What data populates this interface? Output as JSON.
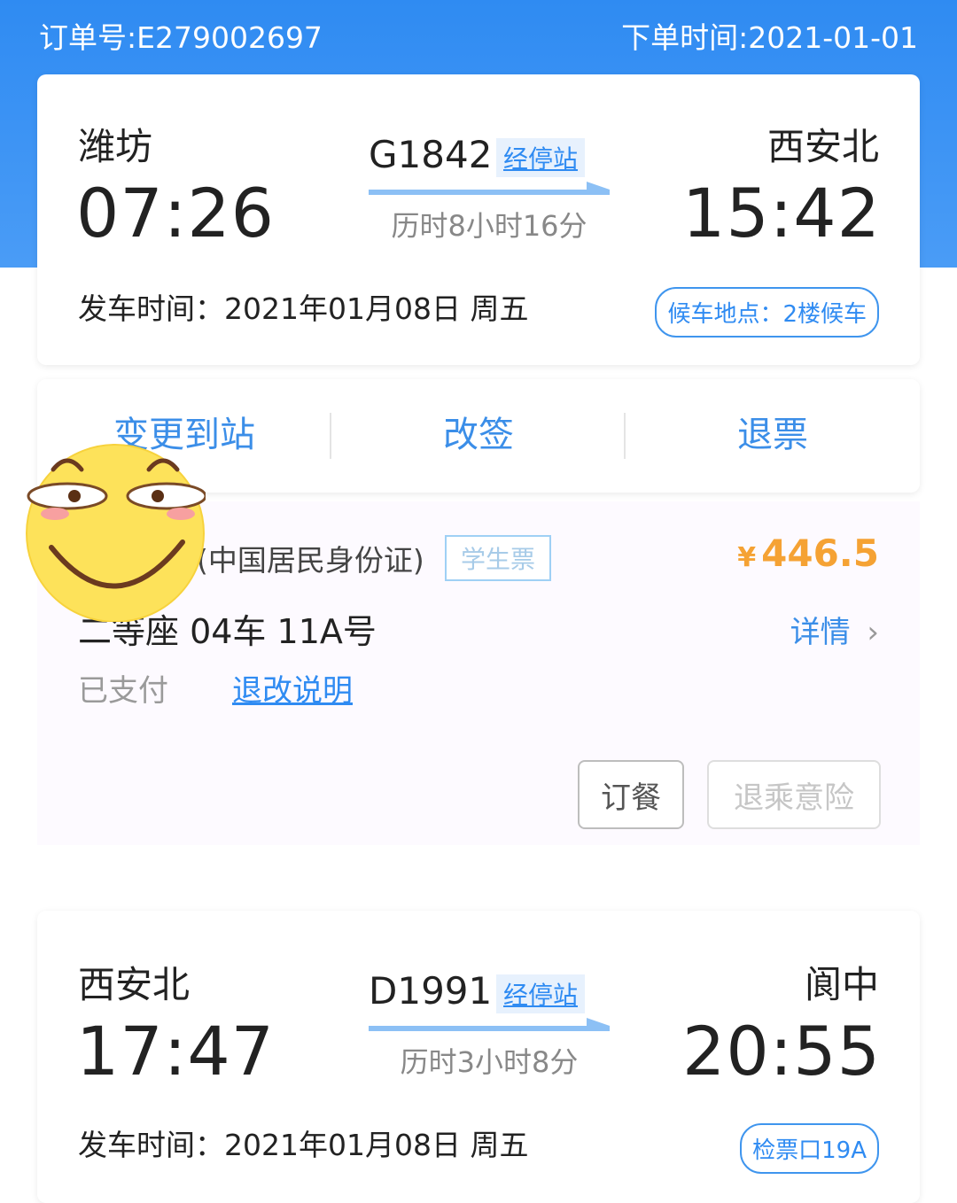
{
  "header": {
    "order_no": "订单号:E279002697",
    "order_time": "下单时间:2021-01-01"
  },
  "trip1": {
    "from_city": "潍坊",
    "to_city": "西安北",
    "depart_time": "07:26",
    "arrive_time": "15:42",
    "train_no": "G1842",
    "stops_label": "经停站",
    "duration": "历时8小时16分",
    "depart_date": "发车时间：2021年01月08日 周五",
    "waiting_area": "候车地点：2楼候车"
  },
  "actions": {
    "change_station": "变更到站",
    "reschedule": "改签",
    "refund": "退票"
  },
  "passenger": {
    "id_type": "(中国居民身份证)",
    "ticket_type": "学生票",
    "price_symbol": "¥",
    "price": "446.5",
    "seat": "二等座 04车 11A号",
    "detail": "详情",
    "detail_chevron": "›",
    "status": "已支付",
    "refund_rules": "退改说明",
    "meal_button": "订餐",
    "insurance_button": "退乘意险"
  },
  "trip2": {
    "from_city": "西安北",
    "to_city": "阆中",
    "depart_time": "17:47",
    "arrive_time": "20:55",
    "train_no": "D1991",
    "stops_label": "经停站",
    "duration": "历时3小时8分",
    "depart_date": "发车时间：2021年01月08日 周五",
    "gate": "检票口19A"
  },
  "colors": {
    "brand_blue": "#2f8bf2",
    "price_orange": "#f5a234"
  }
}
